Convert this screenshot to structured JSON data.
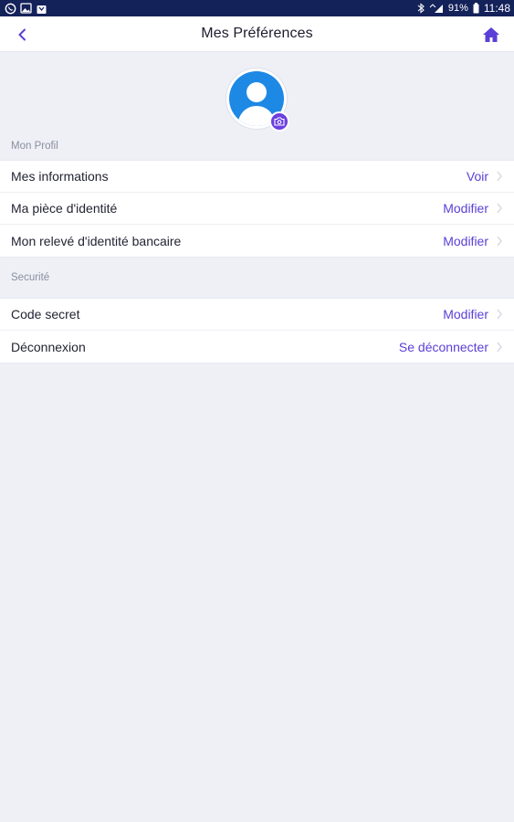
{
  "status_bar": {
    "battery_percent": "91%",
    "time": "11:48"
  },
  "header": {
    "title": "Mes Préférences"
  },
  "colors": {
    "accent": "#5B3FD6",
    "status_bar_bg": "#14225A",
    "avatar_bg": "#1E88E5",
    "page_bg": "#EEF0F6"
  },
  "icons": {
    "back": "chevron-left-icon",
    "home": "home-icon",
    "camera": "camera-icon",
    "avatar": "user-avatar-icon"
  },
  "profile_section": {
    "label": "Mon Profil",
    "rows": [
      {
        "label": "Mes informations",
        "action": "Voir"
      },
      {
        "label": "Ma pièce d'identité",
        "action": "Modifier"
      },
      {
        "label": "Mon relevé d'identité bancaire",
        "action": "Modifier"
      }
    ]
  },
  "security_section": {
    "label": "Securité",
    "rows": [
      {
        "label": "Code secret",
        "action": "Modifier"
      },
      {
        "label": "Déconnexion",
        "action": "Se déconnecter"
      }
    ]
  }
}
